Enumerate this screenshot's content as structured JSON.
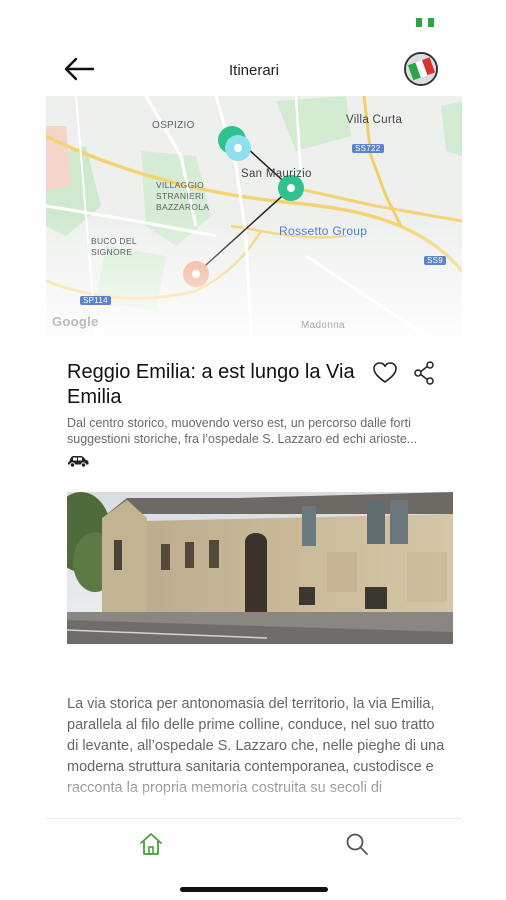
{
  "header": {
    "title": "Itinerari",
    "back_icon": "arrow-left-icon",
    "language_icon": "italian-flag-icon"
  },
  "map": {
    "labels": {
      "ospizio": "OSPIZIO",
      "villa_curta": "Villa Curta",
      "ss722": "SS722",
      "san_maurizio": "San Maurizio",
      "villaggio_1": "VILLAGGIO",
      "villaggio_2": "STRANIERI",
      "villaggio_3": "BAZZAROLA",
      "buco_1": "BUCO DEL",
      "buco_2": "SIGNORE",
      "rossetto": "Rossetto Group",
      "s9": "SS9",
      "sp114": "SP114",
      "madonna": "Madonna",
      "google": "Google"
    }
  },
  "itinerary": {
    "title": "Reggio Emilia: a est lungo la Via Emilia",
    "subtitle": "Dal centro storico, muovendo verso est, un percorso dalle forti suggestioni storiche, fra l’ospedale S. Lazzaro ed echi arioste...",
    "transport_icon": "car-icon",
    "favorite_icon": "heart-icon",
    "share_icon": "share-icon",
    "body": "La via storica per antonomasia del territorio, la via Emilia, parallela al filo delle prime colline, conduce, nel suo tratto di levante, all’ospedale S. Lazzaro che, nelle pieghe di una moderna struttura sanitaria contemporanea, custodisce e racconta la propria memoria costruita su secoli di"
  },
  "tabbar": {
    "home_icon": "home-icon",
    "search_icon": "search-icon",
    "active_color": "#4a9e3f"
  },
  "colors": {
    "accent_green": "#2fc28e",
    "marker_blue": "#8fe0ee",
    "marker_orange": "#f0a58a",
    "flag_green": "#27a844",
    "flag_red": "#d8322f"
  }
}
